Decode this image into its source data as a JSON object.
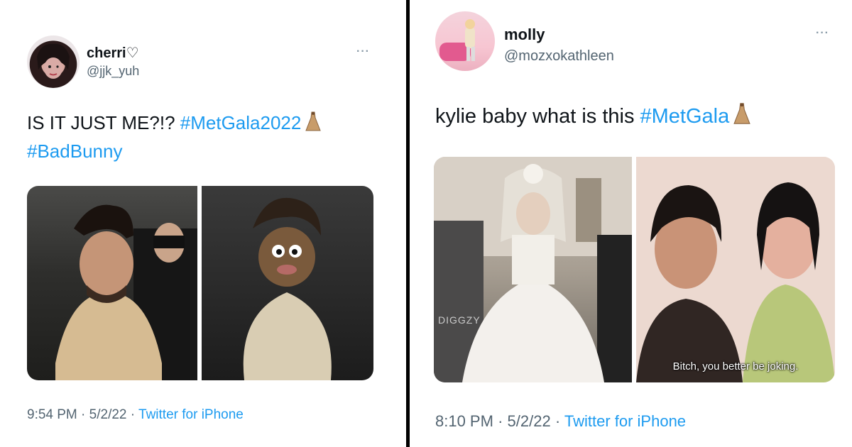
{
  "tweets": [
    {
      "name": "cherri♡",
      "handle": "@jjk_yuh",
      "more": "···",
      "text_plain": "IS IT JUST ME?!? ",
      "hashtags": [
        "#MetGala2022",
        "#BadBunny"
      ],
      "emoji": "dress-emoji",
      "time": "9:54 PM",
      "date": "5/2/22",
      "source": "Twitter for iPhone"
    },
    {
      "name": "molly",
      "handle": "@mozxokathleen",
      "more": "···",
      "text_plain": "kylie baby what is this ",
      "hashtags": [
        "#MetGala"
      ],
      "emoji": "dress-emoji",
      "time": "8:10 PM",
      "date": "5/2/22",
      "source": "Twitter for iPhone",
      "image_caption": "Bitch, you better be joking.",
      "watermark": "DIGGZY"
    }
  ],
  "separator": "·",
  "colors": {
    "link": "#1d9bf0",
    "muted": "#536471",
    "text": "#0f1419",
    "divider": "#000000"
  }
}
